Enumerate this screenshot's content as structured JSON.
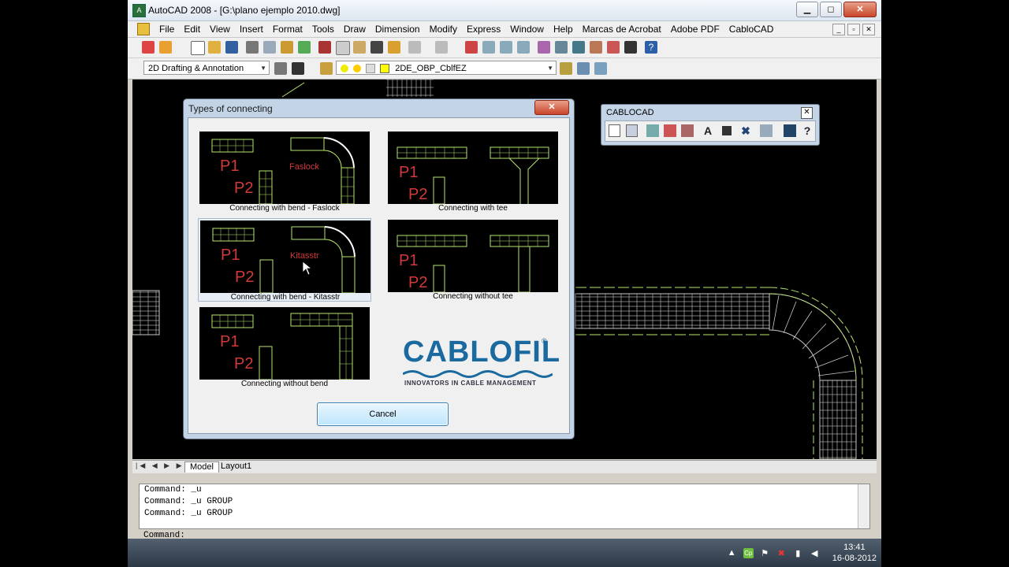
{
  "window": {
    "title": "AutoCAD 2008 - [G:\\plano ejemplo 2010.dwg]",
    "app_icon_label": "A",
    "minimize": "▁",
    "maximize": "◻",
    "close": "✕"
  },
  "menu": {
    "items": [
      "File",
      "Edit",
      "View",
      "Insert",
      "Format",
      "Tools",
      "Draw",
      "Dimension",
      "Modify",
      "Express",
      "Window",
      "Help",
      "Marcas de Acrobat",
      "Adobe PDF",
      "CabloCAD"
    ]
  },
  "toolbar": {
    "workspace": "2D Drafting & Annotation",
    "layer": "2DE_OBP_CblfEZ"
  },
  "layout_tabs": {
    "nav": "|◀ ◀ ▶ ▶|",
    "tabs": [
      "Model",
      "Layout1"
    ]
  },
  "command": {
    "lines": [
      "Command: _u",
      "Command: _u GROUP",
      "Command: _u GROUP"
    ],
    "prompt": "Command:"
  },
  "dialog": {
    "title": "Types of connecting",
    "close": "✕",
    "options": [
      {
        "caption": "Connecting with bend - Faslock",
        "label": "Faslock",
        "p1": "P1",
        "p2": "P2"
      },
      {
        "caption": "Connecting with tee",
        "p1": "P1",
        "p2": "P2"
      },
      {
        "caption": "Connecting with bend - Kitasstr",
        "label": "Kitasstr",
        "p1": "P1",
        "p2": "P2"
      },
      {
        "caption": "Connecting without tee",
        "p1": "P1",
        "p2": "P2"
      },
      {
        "caption": "Connecting without bend",
        "p1": "P1",
        "p2": "P2"
      }
    ],
    "logo_brand": "CABLOFIL",
    "logo_reg": "®",
    "logo_tagline": "INNOVATORS IN CABLE MANAGEMENT",
    "cancel": "Cancel"
  },
  "cablocad": {
    "title": "CABLOCAD",
    "close": "✕",
    "letter_icon": "A",
    "help_icon": "?"
  },
  "taskbar": {
    "time": "13:41",
    "date": "16-08-2012"
  },
  "colors": {
    "tray_green": "#6fbf3f",
    "cad_green": "#b9e66f",
    "cad_red": "#d23a3a",
    "brand_blue": "#1a6aa0"
  }
}
